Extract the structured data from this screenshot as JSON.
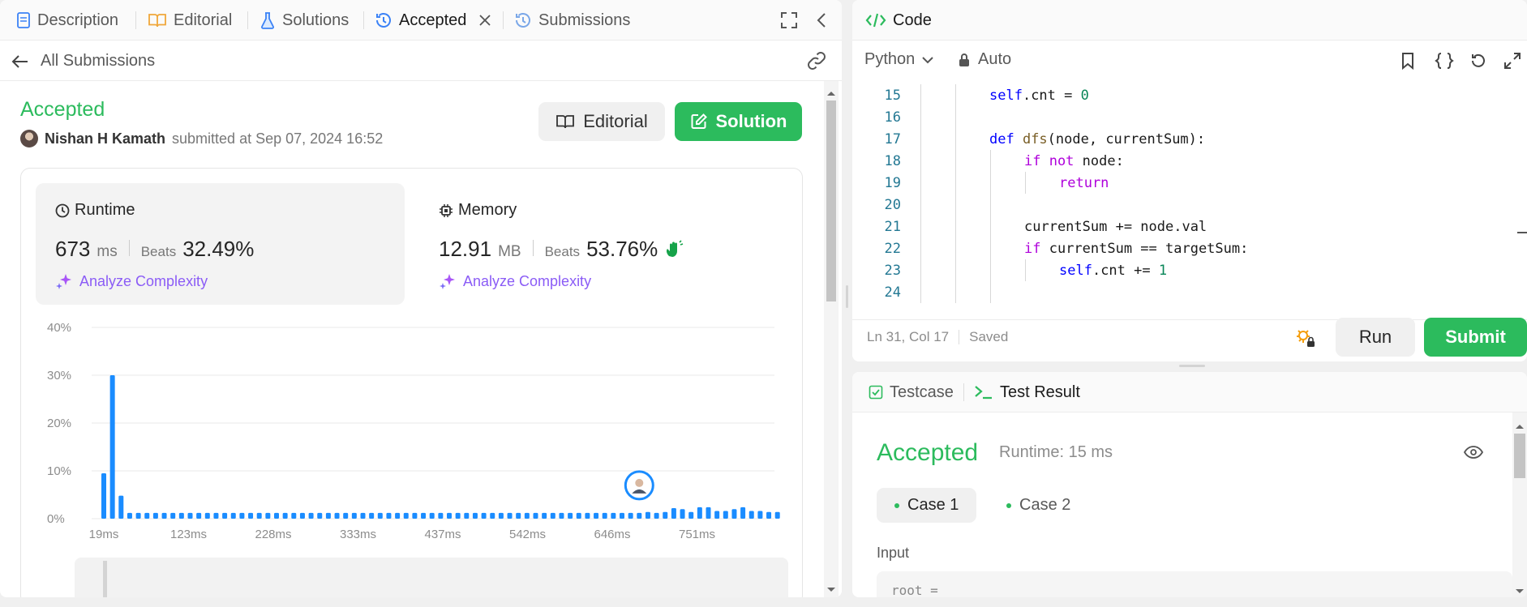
{
  "left_tabs": [
    {
      "label": "Description",
      "icon": "description-icon"
    },
    {
      "label": "Editorial",
      "icon": "book-icon"
    },
    {
      "label": "Solutions",
      "icon": "flask-icon"
    },
    {
      "label": "Accepted",
      "icon": "history-icon",
      "active": true
    },
    {
      "label": "Submissions",
      "icon": "history-icon"
    }
  ],
  "subbar": {
    "back_label": "All Submissions"
  },
  "submission": {
    "status": "Accepted",
    "user": "Nishan H Kamath",
    "submitted_text": "submitted at Sep 07, 2024 16:52",
    "editorial_btn": "Editorial",
    "solution_btn": "Solution"
  },
  "runtime": {
    "title": "Runtime",
    "value": "673",
    "unit": "ms",
    "beats_label": "Beats",
    "beats": "32.49%",
    "analyze": "Analyze Complexity"
  },
  "memory": {
    "title": "Memory",
    "value": "12.91",
    "unit": "MB",
    "beats_label": "Beats",
    "beats": "53.76%",
    "analyze": "Analyze Complexity"
  },
  "chart_data": {
    "type": "bar",
    "ylim": [
      0,
      40
    ],
    "y_ticks": [
      "0%",
      "10%",
      "20%",
      "30%",
      "40%"
    ],
    "x_ticks": [
      "19ms",
      "123ms",
      "228ms",
      "333ms",
      "437ms",
      "542ms",
      "646ms",
      "751ms"
    ],
    "values": [
      9.5,
      30,
      4.8,
      1.2,
      1.2,
      1.2,
      1.2,
      1.2,
      1.2,
      1.2,
      1.2,
      1.2,
      1.2,
      1.2,
      1.2,
      1.2,
      1.2,
      1.2,
      1.2,
      1.2,
      1.2,
      1.2,
      1.2,
      1.2,
      1.2,
      1.2,
      1.2,
      1.2,
      1.2,
      1.2,
      1.2,
      1.2,
      1.2,
      1.2,
      1.2,
      1.2,
      1.2,
      1.2,
      1.2,
      1.2,
      1.2,
      1.2,
      1.2,
      1.2,
      1.2,
      1.2,
      1.2,
      1.2,
      1.2,
      1.2,
      1.2,
      1.2,
      1.2,
      1.2,
      1.2,
      1.2,
      1.2,
      1.2,
      1.2,
      1.2,
      1.2,
      1.2,
      1.2,
      1.4,
      1.2,
      1.4,
      2.2,
      2,
      1.4,
      2.4,
      2.4,
      1.6,
      1.6,
      2,
      2.4,
      1.6,
      1.6,
      1.4,
      1.4
    ],
    "highlight_index": 62,
    "grid": true,
    "color": "#1a8cff"
  },
  "code_header": {
    "title": "Code",
    "language": "Python",
    "mode": "Auto"
  },
  "code_lines": [
    {
      "n": "15",
      "indent": 2
    },
    {
      "n": "16",
      "indent": 0
    },
    {
      "n": "17",
      "indent": 2
    },
    {
      "n": "18",
      "indent": 3
    },
    {
      "n": "19",
      "indent": 4
    },
    {
      "n": "20",
      "indent": 0
    },
    {
      "n": "21",
      "indent": 3
    },
    {
      "n": "22",
      "indent": 3
    },
    {
      "n": "23",
      "indent": 4
    },
    {
      "n": "24",
      "indent": 0
    }
  ],
  "code_tokens": {
    "l15a": "self",
    "l15b": ".cnt = ",
    "l15c": "0",
    "l17a": "def ",
    "l17b": "dfs",
    "l17c": "(node, currentSum):",
    "l18a": "if not ",
    "l18b": "node:",
    "l19a": "return",
    "l21a": "currentSum += node.val",
    "l22a": "if ",
    "l22b": "currentSum == targetSum:",
    "l23a": "self",
    "l23b": ".cnt += ",
    "l23c": "1"
  },
  "editor_status": {
    "position": "Ln 31, Col 17",
    "saved": "Saved",
    "run": "Run",
    "submit": "Submit"
  },
  "result_tabs": {
    "testcase": "Testcase",
    "test_result": "Test Result"
  },
  "result": {
    "status": "Accepted",
    "runtime": "Runtime: 15 ms",
    "cases": [
      "Case 1",
      "Case 2"
    ],
    "input_label": "Input",
    "input_value": "root ="
  },
  "colors": {
    "accent_green": "#2cbb5d",
    "blue": "#1a8cff",
    "purple": "#a855f7"
  }
}
